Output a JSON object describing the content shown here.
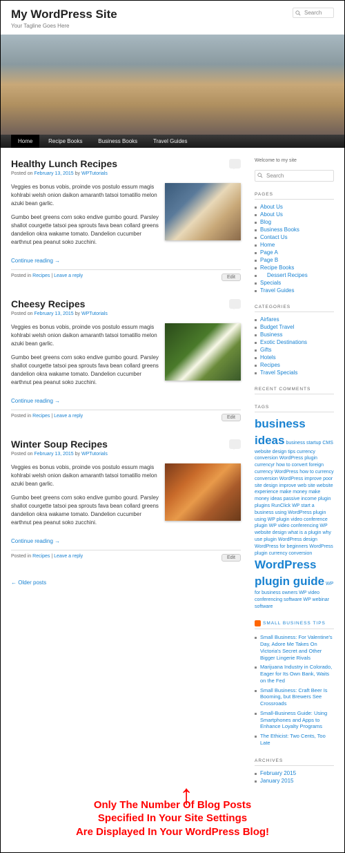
{
  "header": {
    "title": "My WordPress Site",
    "tagline": "Your Tagline Goes Here",
    "search_placeholder": "Search"
  },
  "nav": [
    "Home",
    "Recipe Books",
    "Business Books",
    "Travel Guides"
  ],
  "posts": [
    {
      "title": "Healthy Lunch Recipes",
      "date": "February 13, 2015",
      "author": "WPTutorials",
      "p1": "Veggies es bonus vobis, proinde vos postulo essum magis kohlrabi welsh onion daikon amaranth tatsoi tomatillo melon azuki bean garlic.",
      "p2": "Gumbo beet greens corn soko endive gumbo gourd. Parsley shallot courgette tatsoi pea sprouts fava bean collard greens dandelion okra wakame tomato. Dandelion cucumber earthnut pea peanut soko zucchini.",
      "continue": "Continue reading →",
      "cat": "Recipes",
      "reply": "Leave a reply",
      "edit": "Edit"
    },
    {
      "title": "Cheesy Recipes",
      "date": "February 13, 2015",
      "author": "WPTutorials",
      "p1": "Veggies es bonus vobis, proinde vos postulo essum magis kohlrabi welsh onion daikon amaranth tatsoi tomatillo melon azuki bean garlic.",
      "p2": "Gumbo beet greens corn soko endive gumbo gourd. Parsley shallot courgette tatsoi pea sprouts fava bean collard greens dandelion okra wakame tomato. Dandelion cucumber earthnut pea peanut soko zucchini.",
      "continue": "Continue reading →",
      "cat": "Recipes",
      "reply": "Leave a reply",
      "edit": "Edit"
    },
    {
      "title": "Winter Soup Recipes",
      "date": "February 13, 2015",
      "author": "WPTutorials",
      "p1": "Veggies es bonus vobis, proinde vos postulo essum magis kohlrabi welsh onion daikon amaranth tatsoi tomatillo melon azuki bean garlic.",
      "p2": "Gumbo beet greens corn soko endive gumbo gourd. Parsley shallot courgette tatsoi pea sprouts fava bean collard greens dandelion okra wakame tomato. Dandelion cucumber earthnut pea peanut soko zucchini.",
      "continue": "Continue reading →",
      "cat": "Recipes",
      "reply": "Leave a reply",
      "edit": "Edit"
    }
  ],
  "older": "← Older posts",
  "sidebar": {
    "welcome": "Welcome to my site",
    "search_placeholder": "Search",
    "pages_title": "PAGES",
    "pages": [
      "About Us",
      "About Us",
      "Blog",
      "Business Books",
      "Contact Us",
      "Home",
      "Page A",
      "Page B",
      "Recipe Books"
    ],
    "pages_sub": "Dessert Recipes",
    "pages2": [
      "Specials",
      "Travel Guides"
    ],
    "cats_title": "CATEGORIES",
    "cats": [
      "Airfares",
      "Budget Travel",
      "Business",
      "Exotic Destinations",
      "Gifts",
      "Hotels",
      "Recipes",
      "Travel Specials"
    ],
    "recent_title": "RECENT COMMENTS",
    "tags_title": "TAGS",
    "tags_big1": "business ideas",
    "tags_small": "business startup CMS website design tips currency conversion WordPress plugin currencyr how to convert foreign currency WordPress how to currency conversion WordPress improve poor site design improve web site website experience make money make money ideas passive income plugin plugins RunClick WP start a business using WordPress plugin using WP plugin video conference plugin WP video conferencing WP website design what is a plugin why use plugin WordPress design WordPress for beginners WordPress plugin currency conversion",
    "tags_big2": "WordPress plugin guide",
    "tags_small2": "WP for business owners WP video conferencing software WP webinar software",
    "rss_title": "SMALL BUSINESS TIPS",
    "rss_items": [
      "Small Business: For Valentine's Day, Adore Me Takes On Victoria's Secret and Other Bigger Lingerie Rivals",
      "Marijuana Industry in Colorado, Eager for Its Own Bank, Waits on the Fed",
      "Small Business: Craft Beer Is Booming, but Brewers See Crossroads",
      "Small-Business Guide: Using Smartphones and Apps to Enhance Loyalty Programs",
      "The Ethicist: Two Cents, Too Late"
    ],
    "archives_title": "ARCHIVES",
    "archives": [
      "February 2015",
      "January 2015"
    ]
  },
  "labels": {
    "posted_on": "Posted on ",
    "by": " by ",
    "posted_in": "Posted in ",
    "sep": " | "
  },
  "annotation": {
    "line1": "Only The Number Of Blog Posts",
    "line2": "Specified In Your Site Settings",
    "line3": "Are Displayed In Your WordPress Blog!"
  }
}
